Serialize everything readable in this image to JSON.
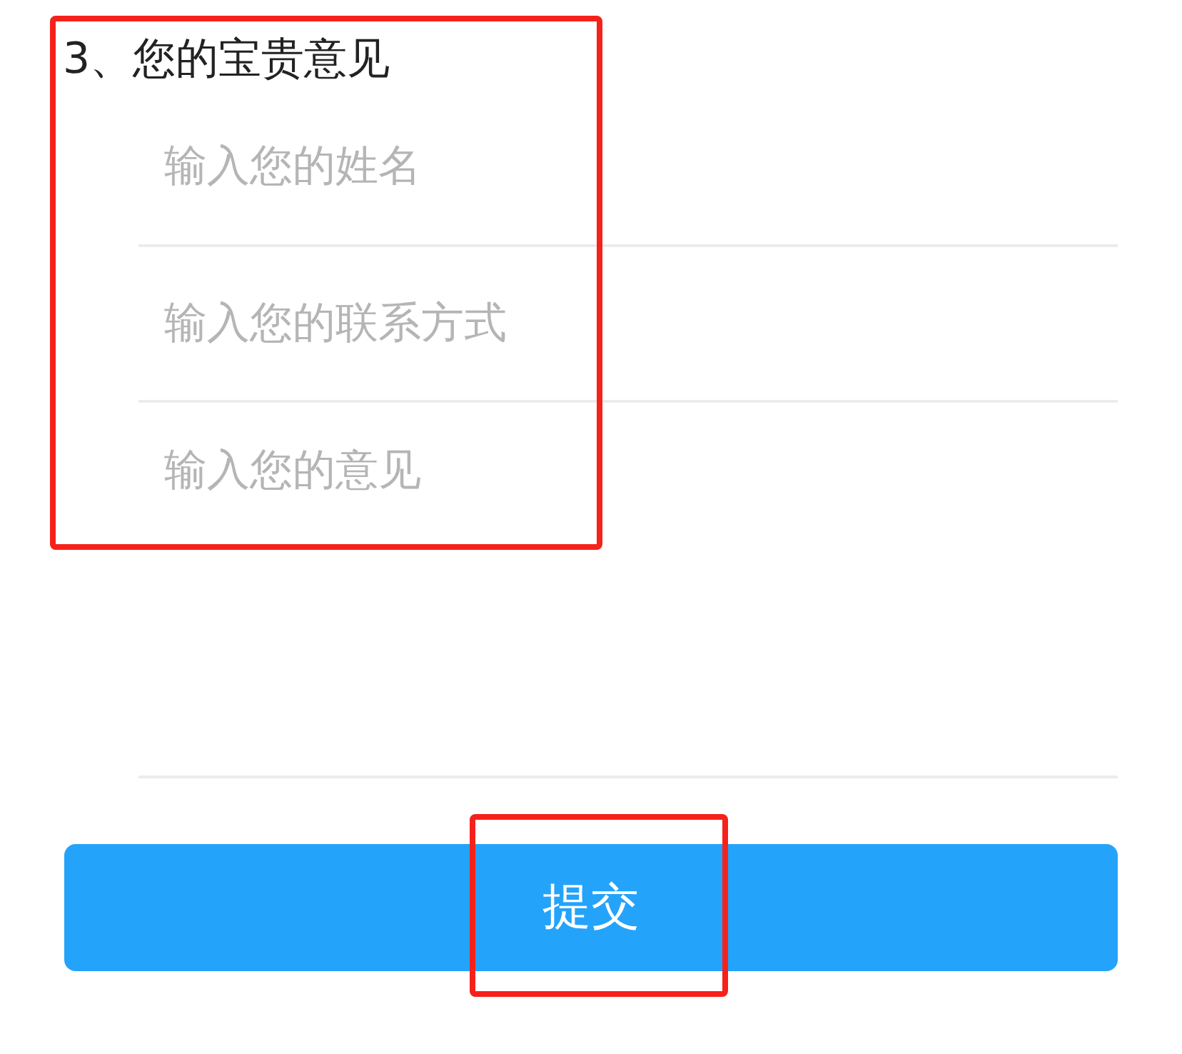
{
  "section_title": "3、您的宝贵意见",
  "fields": [
    {
      "kind": "input",
      "placeholder": "输入您的姓名"
    },
    {
      "kind": "input",
      "placeholder": "输入您的联系方式"
    },
    {
      "kind": "textarea",
      "placeholder": "输入您的意见"
    }
  ],
  "submit_button": "提交"
}
